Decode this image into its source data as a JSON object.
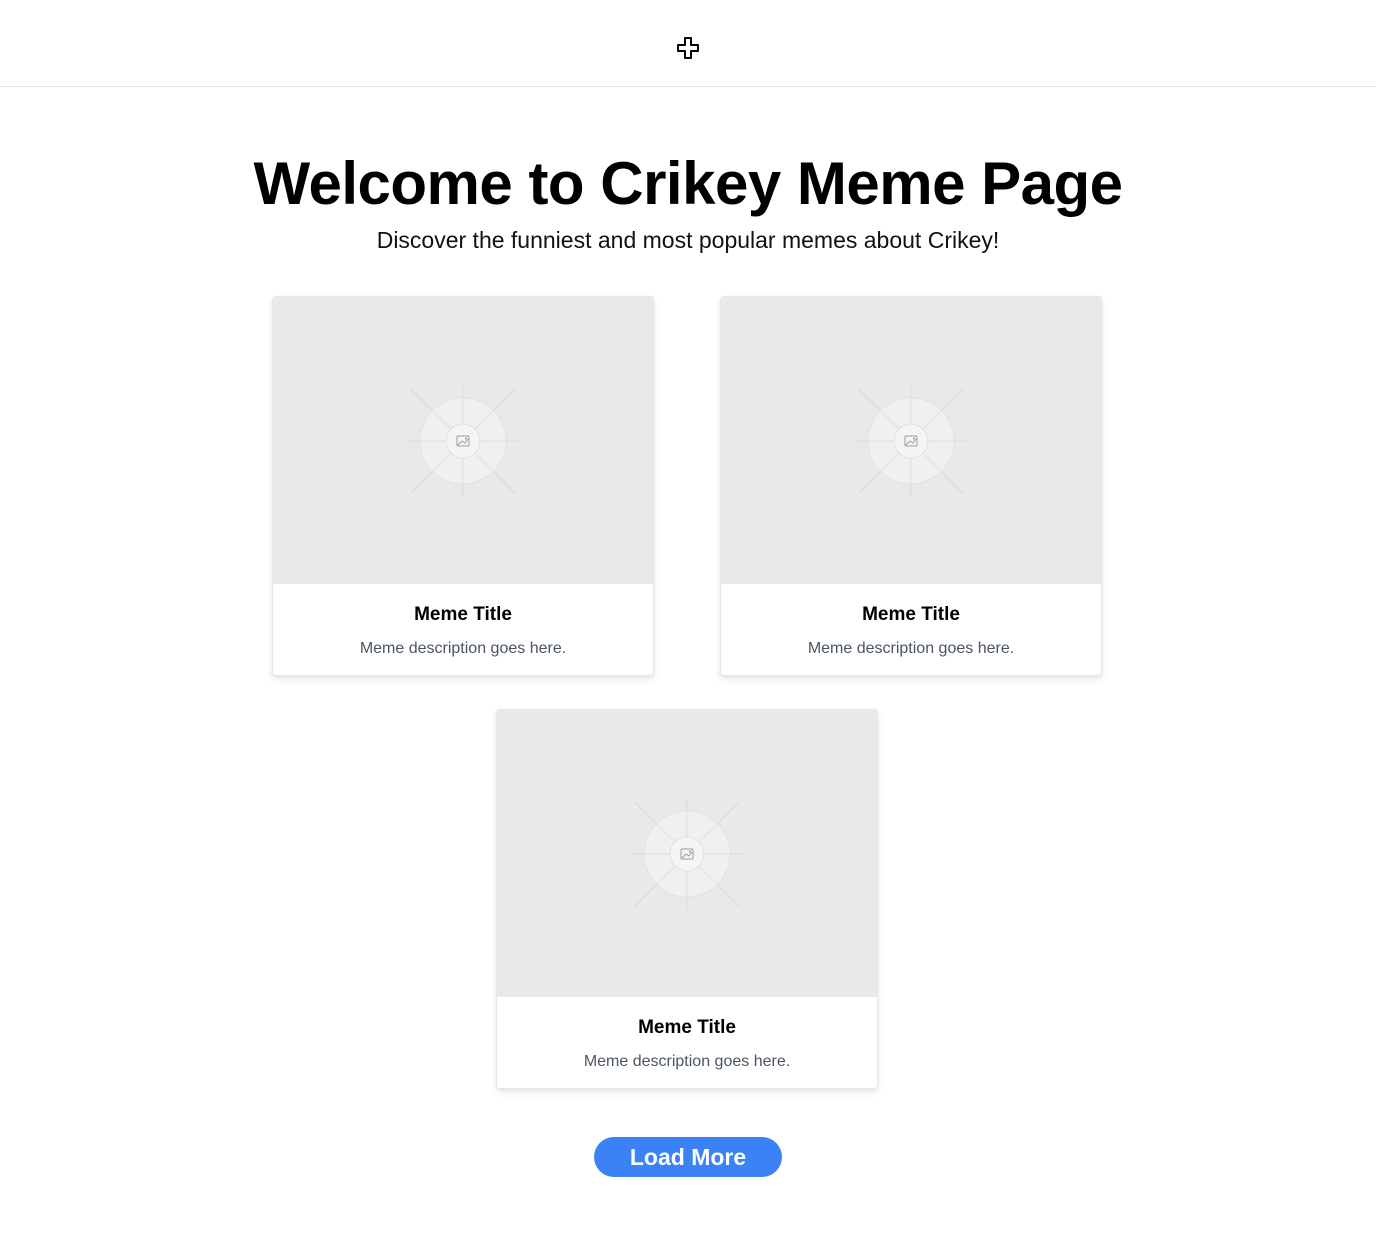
{
  "header": {
    "logo_icon": "plus-cross-icon"
  },
  "hero": {
    "title": "Welcome to Crikey Meme Page",
    "subtitle": "Discover the funniest and most popular memes about Crikey!"
  },
  "memes": [
    {
      "title": "Meme Title",
      "description": "Meme description goes here.",
      "image_icon": "image-placeholder-icon"
    },
    {
      "title": "Meme Title",
      "description": "Meme description goes here.",
      "image_icon": "image-placeholder-icon"
    },
    {
      "title": "Meme Title",
      "description": "Meme description goes here.",
      "image_icon": "image-placeholder-icon"
    }
  ],
  "actions": {
    "load_more_label": "Load More"
  },
  "colors": {
    "accent": "#3b82f6",
    "placeholder_bg": "#e9e9e9",
    "description_text": "#4b5563"
  }
}
